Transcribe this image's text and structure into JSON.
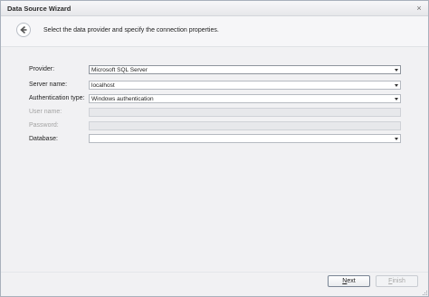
{
  "window": {
    "title": "Data Source Wizard",
    "close_glyph": "×"
  },
  "header": {
    "instruction": "Select the data provider and specify the connection properties."
  },
  "form": {
    "provider": {
      "label": "Provider:",
      "value": "Microsoft SQL Server"
    },
    "server": {
      "label": "Server name:",
      "value": "localhost"
    },
    "auth": {
      "label": "Authentication type:",
      "value": "Windows authentication"
    },
    "username": {
      "label": "User name:",
      "value": ""
    },
    "password": {
      "label": "Password:",
      "value": ""
    },
    "database": {
      "label": "Database:",
      "value": ""
    }
  },
  "buttons": {
    "next_mnemonic": "N",
    "next_rest": "ext",
    "finish_mnemonic": "F",
    "finish_rest": "inish"
  },
  "icons": {
    "back": "back-arrow-icon",
    "dropdown": "chevron-down-icon"
  }
}
